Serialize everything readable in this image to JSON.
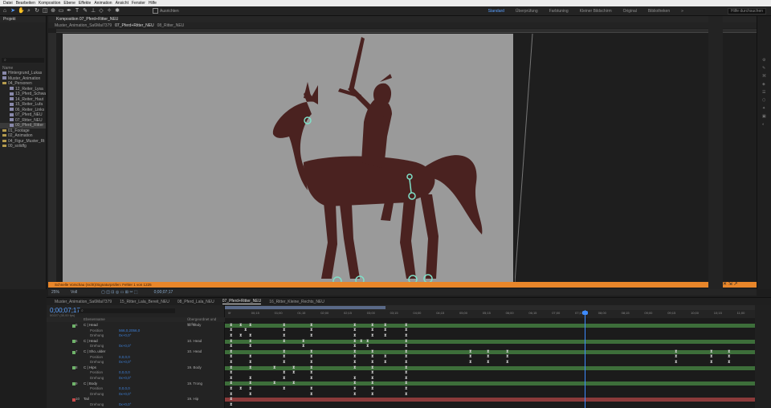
{
  "menu": [
    "Datei",
    "Bearbeiten",
    "Komposition",
    "Ebene",
    "Effekte",
    "Animation",
    "Ansicht",
    "Fenster",
    "Hilfe"
  ],
  "toolbar": {
    "snap_label": "Ausrichten",
    "workspaces": [
      {
        "label": "Standard",
        "active": true
      },
      {
        "label": "Überprüfung",
        "active": false
      },
      {
        "label": "Farbtuning",
        "active": false
      },
      {
        "label": "Kleiner Bildschirm",
        "active": false
      },
      {
        "label": "Original",
        "active": false
      },
      {
        "label": "Bibliotheken",
        "active": false
      }
    ],
    "search_placeholder": "Hilfe durchsuchen"
  },
  "project": {
    "title": "Projekt",
    "column": "Name",
    "items": [
      {
        "label": "Hintergrund_Lukas",
        "type": "comp",
        "sub": false
      },
      {
        "label": "Muster_Animation",
        "type": "comp",
        "sub": false
      },
      {
        "label": "04_Personen",
        "type": "folder",
        "sub": false
      },
      {
        "label": "12_Reiter_Lysa",
        "type": "comp",
        "sub": true
      },
      {
        "label": "13_Pferd_Schwa",
        "type": "comp",
        "sub": true
      },
      {
        "label": "14_Reiter_Haut",
        "type": "comp",
        "sub": true
      },
      {
        "label": "15_Reiter_Lufa",
        "type": "comp",
        "sub": true
      },
      {
        "label": "06_Reiter_Links",
        "type": "comp",
        "sub": true
      },
      {
        "label": "07_Pferd_NEU",
        "type": "comp",
        "sub": true
      },
      {
        "label": "07_Ritter_NEU",
        "type": "comp",
        "sub": true
      },
      {
        "label": "00_Pferd_Ritter",
        "type": "comp",
        "sub": true
      },
      {
        "label": "01_Footage",
        "type": "folder",
        "sub": false
      },
      {
        "label": "02_Animation",
        "type": "folder",
        "sub": false
      },
      {
        "label": "04_Figur_Muster_Rt",
        "type": "folder",
        "sub": false
      },
      {
        "label": "00_solidfg",
        "type": "folder",
        "sub": false
      }
    ]
  },
  "viewer": {
    "tab": "Komposition 07_Pferd+Ritter_NEU",
    "breadcrumbs": [
      "Muster_Animation_Sa6Mai7379",
      "07_Pferd+Ritter_NEU",
      "08_Ritter_NEU"
    ],
    "warning": "Schnelle Vorschau (nicht)/Signaturprüfen: Fehler 1 von 1225",
    "zoom": "25%",
    "quality": "Voll",
    "timecode": "0;00;07;17"
  },
  "timeline": {
    "tabs": [
      {
        "label": "Muster_Animation_Sa6Mai7379",
        "active": false
      },
      {
        "label": "15_Ritter_Lala_Bereit_NEU",
        "active": false
      },
      {
        "label": "08_Pferd_Lala_NEU",
        "active": false
      },
      {
        "label": "07_Pferd+Ritter_NEU",
        "active": true
      },
      {
        "label": "16_Ritter_Kleine_Rechts_NEU",
        "active": false
      }
    ],
    "timecode": "0;00;07;17",
    "fps": "00227 (30,00 fps)",
    "header": {
      "name": "Ebenenname",
      "parent": "Übergeordnet und verkn."
    },
    "ruler": [
      "0f",
      "00;15",
      "01;00",
      "01;15",
      "02;00",
      "02;15",
      "03;00",
      "03;15",
      "04;00",
      "04;15",
      "05;00",
      "05;15",
      "06;00",
      "06;15",
      "07;00",
      "07;15",
      "08;00",
      "08;15",
      "09;00",
      "09;15",
      "10;00",
      "10;15",
      "11;00"
    ],
    "layers": [
      {
        "num": "5",
        "name": "C | Head",
        "parent": "11. Body",
        "color": "#6fb36a",
        "kind": "layer"
      },
      {
        "name": "Position",
        "value": "566,0,2056,0",
        "kind": "prop"
      },
      {
        "name": "Drehung",
        "value": "0x+0,0°",
        "kind": "prop"
      },
      {
        "num": "6",
        "name": "C | Head",
        "parent": "10. Head",
        "color": "#6fb36a",
        "kind": "layer"
      },
      {
        "name": "Drehung",
        "value": "0x+0,0°",
        "kind": "prop"
      },
      {
        "num": "7",
        "name": "C | Sho..ulder",
        "parent": "10. Head",
        "color": "#6fb36a",
        "kind": "layer"
      },
      {
        "name": "Position",
        "value": "0,0,0,0",
        "kind": "prop"
      },
      {
        "name": "Drehung",
        "value": "0x+0,0°",
        "kind": "prop"
      },
      {
        "num": "8",
        "name": "C | Hips",
        "parent": "19. Body",
        "color": "#6fb36a",
        "kind": "layer"
      },
      {
        "name": "Position",
        "value": "0,0,0,0",
        "kind": "prop"
      },
      {
        "name": "Drehung",
        "value": "0x+0,0°",
        "kind": "prop"
      },
      {
        "num": "9",
        "name": "C | Body",
        "parent": "19. Trong",
        "color": "#6fb36a",
        "kind": "layer"
      },
      {
        "name": "Position",
        "value": "0,0,0,0",
        "kind": "prop"
      },
      {
        "name": "Drehung",
        "value": "0x+0,0°",
        "kind": "prop"
      },
      {
        "num": "10",
        "name": "Tail",
        "parent": "19. Hip",
        "color": "#c84a4a",
        "kind": "layer"
      },
      {
        "name": "Drehung",
        "value": "0x+0,0°",
        "kind": "prop"
      }
    ]
  }
}
